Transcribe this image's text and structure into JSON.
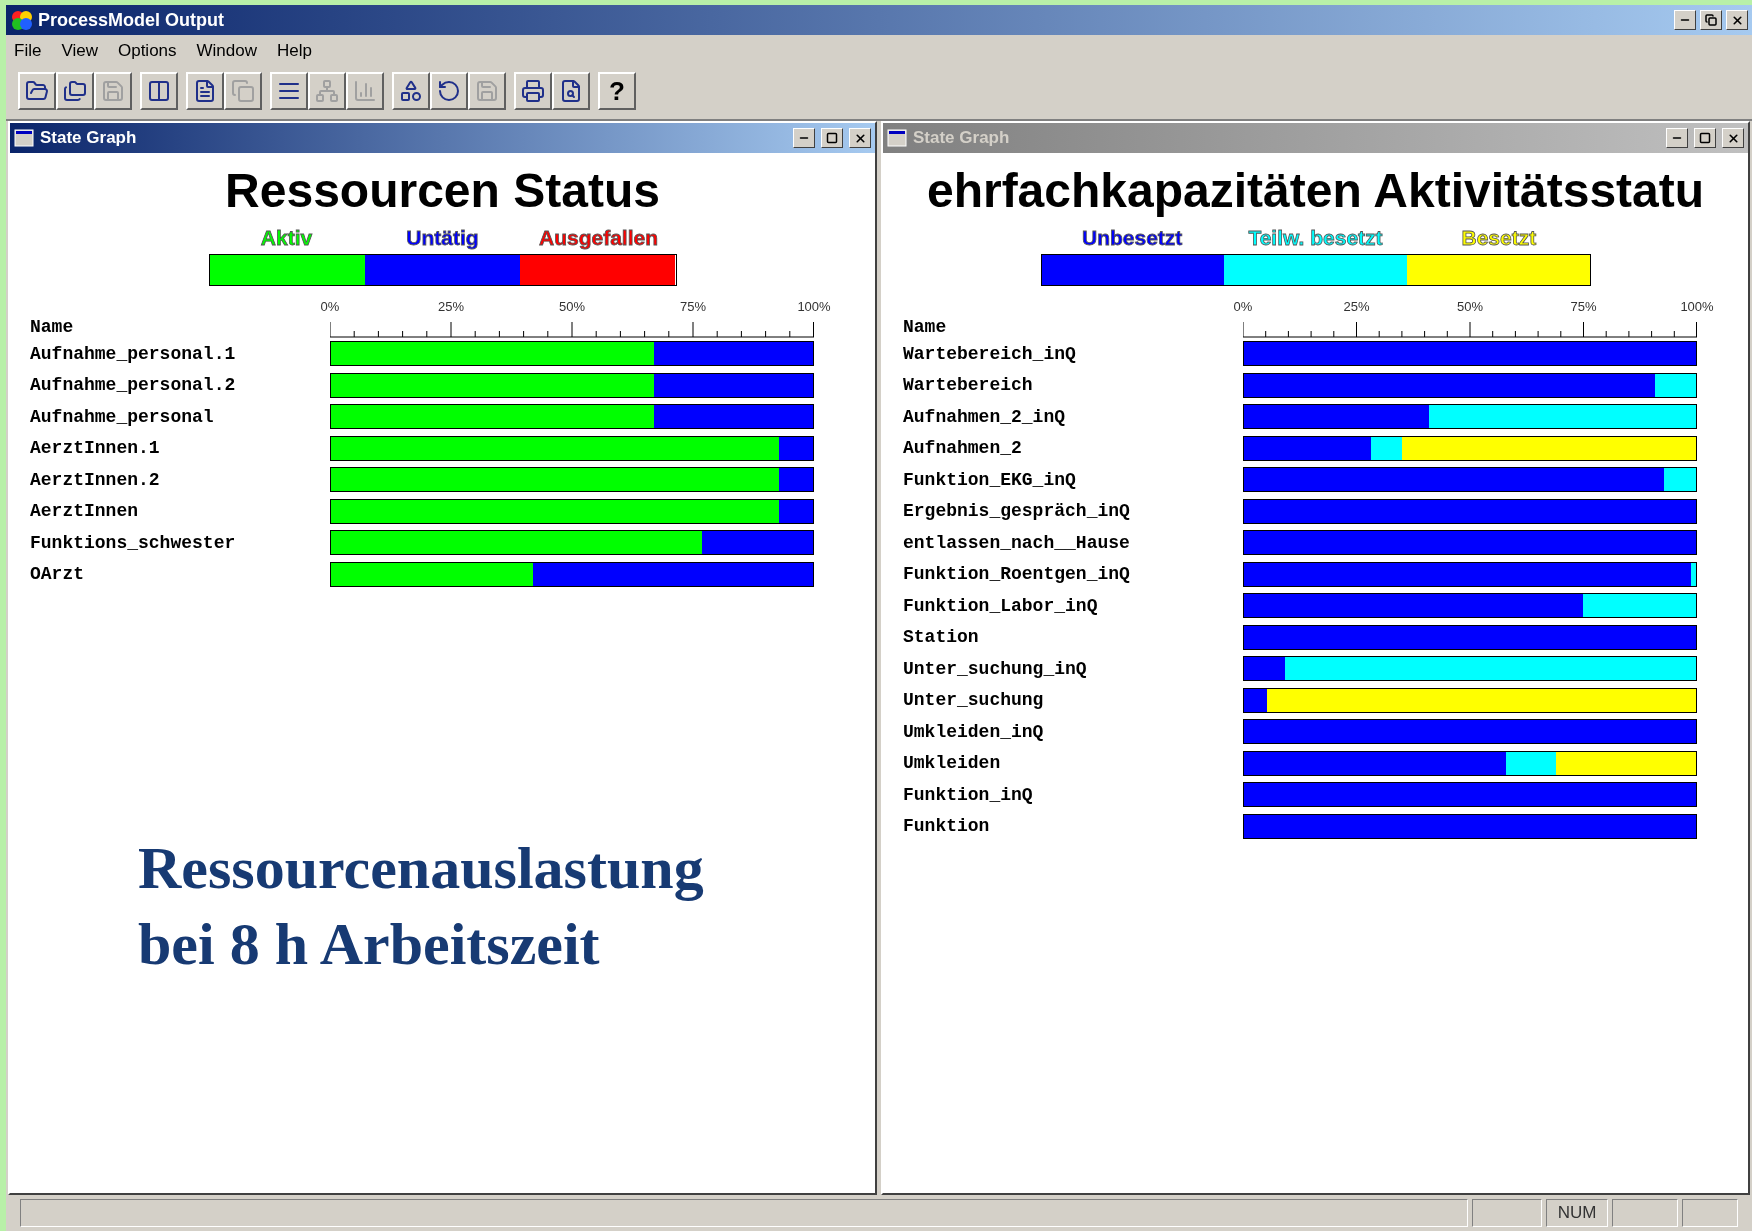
{
  "window": {
    "title": "ProcessModel Output"
  },
  "menu": [
    "File",
    "View",
    "Options",
    "Window",
    "Help"
  ],
  "toolbar": [
    [
      {
        "kind": "open",
        "disabled": false
      },
      {
        "kind": "open_multi",
        "disabled": false
      },
      {
        "kind": "save",
        "disabled": true
      }
    ],
    [
      {
        "kind": "fit",
        "disabled": false
      }
    ],
    [
      {
        "kind": "document",
        "disabled": false
      },
      {
        "kind": "copy",
        "disabled": true
      }
    ],
    [
      {
        "kind": "bars",
        "disabled": false
      },
      {
        "kind": "network",
        "disabled": true
      },
      {
        "kind": "chart",
        "disabled": true
      }
    ],
    [
      {
        "kind": "shapes",
        "disabled": false
      },
      {
        "kind": "replay",
        "disabled": false
      },
      {
        "kind": "save",
        "disabled": true
      }
    ],
    [
      {
        "kind": "print",
        "disabled": false
      },
      {
        "kind": "preview",
        "disabled": false
      }
    ],
    [
      {
        "kind": "help",
        "disabled": false,
        "label": "?"
      }
    ]
  ],
  "panels": [
    {
      "title": "State Graph",
      "active": true,
      "annotation": [
        "Ressourcenauslastung",
        "bei 8 h Arbeitszeit"
      ],
      "chart_data": {
        "type": "bar",
        "orientation": "horizontal",
        "stacked": true,
        "title": "Ressourcen Status",
        "ylabel": "Name",
        "xlim": [
          0,
          100
        ],
        "xticks": [
          {
            "value": 0,
            "label": "0%"
          },
          {
            "value": 25,
            "label": "25%"
          },
          {
            "value": 50,
            "label": "50%"
          },
          {
            "value": 75,
            "label": "75%"
          },
          {
            "value": 100,
            "label": "100%"
          }
        ],
        "categories": [
          "Aufnahme_personal.1",
          "Aufnahme_personal.2",
          "Aufnahme_personal",
          "AerztInnen.1",
          "AerztInnen.2",
          "AerztInnen",
          "Funktions_schwester",
          "OArzt"
        ],
        "series": [
          {
            "name": "Aktiv",
            "color": "#00ff00",
            "values": [
              67,
              67,
              67,
              93,
              93,
              93,
              77,
              42
            ]
          },
          {
            "name": "Untätig",
            "color": "#0000ff",
            "values": [
              33,
              33,
              33,
              7,
              7,
              7,
              23,
              58
            ]
          },
          {
            "name": "Ausgefallen",
            "color": "#ff0000",
            "values": [
              0,
              0,
              0,
              0,
              0,
              0,
              0,
              0
            ]
          }
        ]
      }
    },
    {
      "title": "State Graph",
      "active": false,
      "chart_data": {
        "type": "bar",
        "orientation": "horizontal",
        "stacked": true,
        "title": "ehrfachkapazitäten Aktivitätsstatu",
        "ylabel": "Name",
        "xlim": [
          0,
          100
        ],
        "xticks": [
          {
            "value": 0,
            "label": "0%"
          },
          {
            "value": 25,
            "label": "25%"
          },
          {
            "value": 50,
            "label": "50%"
          },
          {
            "value": 75,
            "label": "75%"
          },
          {
            "value": 100,
            "label": "100%"
          }
        ],
        "categories": [
          "Wartebereich_inQ",
          "Wartebereich",
          "Aufnahmen_2_inQ",
          "Aufnahmen_2",
          "Funktion_EKG_inQ",
          "Ergebnis_gespräch_inQ",
          "entlassen_nach__Hause",
          "Funktion_Roentgen_inQ",
          "Funktion_Labor_inQ",
          "Station",
          "Unter_suchung_inQ",
          "Unter_suchung",
          "Umkleiden_inQ",
          "Umkleiden",
          "Funktion_inQ",
          "Funktion"
        ],
        "series": [
          {
            "name": "Unbesetzt",
            "color": "#0000ff",
            "values": [
              100,
              91,
              41,
              28,
              93,
              100,
              100,
              99,
              75,
              100,
              9,
              5,
              100,
              58,
              100,
              100
            ]
          },
          {
            "name": "Teilw. besetzt",
            "color": "#00ffff",
            "values": [
              0,
              9,
              59,
              7,
              7,
              0,
              0,
              1,
              25,
              0,
              91,
              0,
              0,
              11,
              0,
              0
            ]
          },
          {
            "name": "Besetzt",
            "color": "#ffff00",
            "values": [
              0,
              0,
              0,
              65,
              0,
              0,
              0,
              0,
              0,
              0,
              0,
              95,
              0,
              31,
              0,
              0
            ]
          }
        ]
      }
    }
  ],
  "status_bar": {
    "indicator": "NUM"
  }
}
